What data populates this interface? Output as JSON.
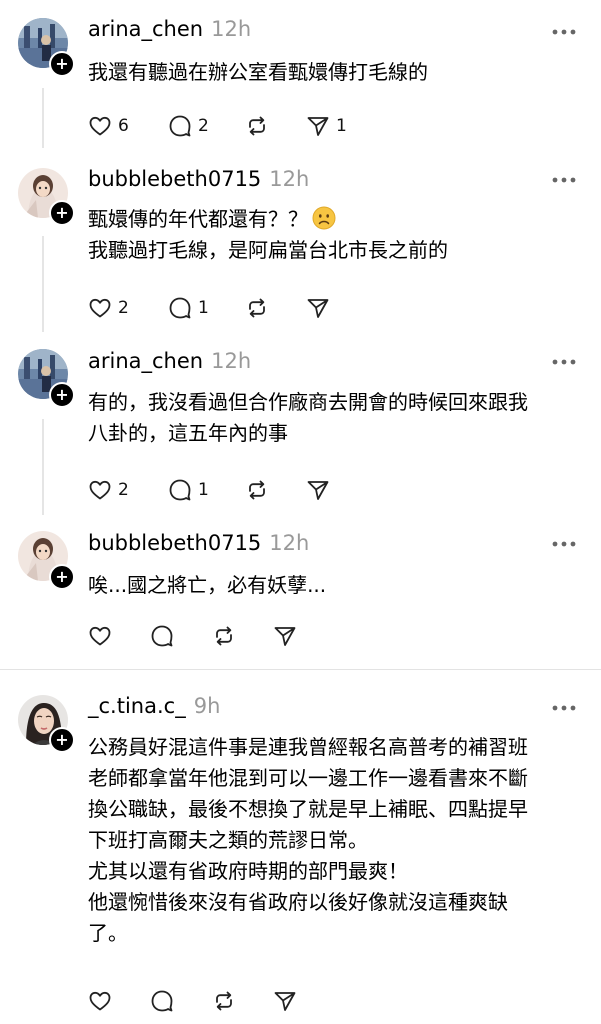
{
  "comments": [
    {
      "username": "arina_chen",
      "time": "12h",
      "lines": [
        "我還有聽過在辦公室看甄嬛傳打毛線的"
      ],
      "likes": "6",
      "replies": "2",
      "reposts": "",
      "shares": "1"
    },
    {
      "username": "bubblebeth0715",
      "time": "12h",
      "lines": [
        "甄嬛傳的年代都還有？？",
        "我聽過打毛線，是阿扁當台北市長之前的"
      ],
      "emoji": "worried-face",
      "likes": "2",
      "replies": "1",
      "reposts": "",
      "shares": ""
    },
    {
      "username": "arina_chen",
      "time": "12h",
      "lines": [
        "有的，我沒看過但合作廠商去開會的時候回來跟我",
        "八卦的，這五年內的事"
      ],
      "likes": "2",
      "replies": "1",
      "reposts": "",
      "shares": ""
    },
    {
      "username": "bubblebeth0715",
      "time": "12h",
      "lines": [
        "唉...國之將亡，必有妖孽..."
      ],
      "likes": "",
      "replies": "",
      "reposts": "",
      "shares": ""
    },
    {
      "username": "_c.tina.c_",
      "time": "9h",
      "lines": [
        "公務員好混這件事是連我曾經報名高普考的補習班",
        "老師都拿當年他混到可以一邊工作一邊看書來不斷",
        "換公職缺，最後不想換了就是早上補眠、四點提早",
        "下班打高爾夫之類的荒謬日常。",
        "尤其以還有省政府時期的部門最爽！",
        "他還惋惜後來沒有省政府以後好像就沒這種爽缺",
        "了。"
      ],
      "likes": "",
      "replies": "",
      "reposts": "",
      "shares": ""
    }
  ]
}
